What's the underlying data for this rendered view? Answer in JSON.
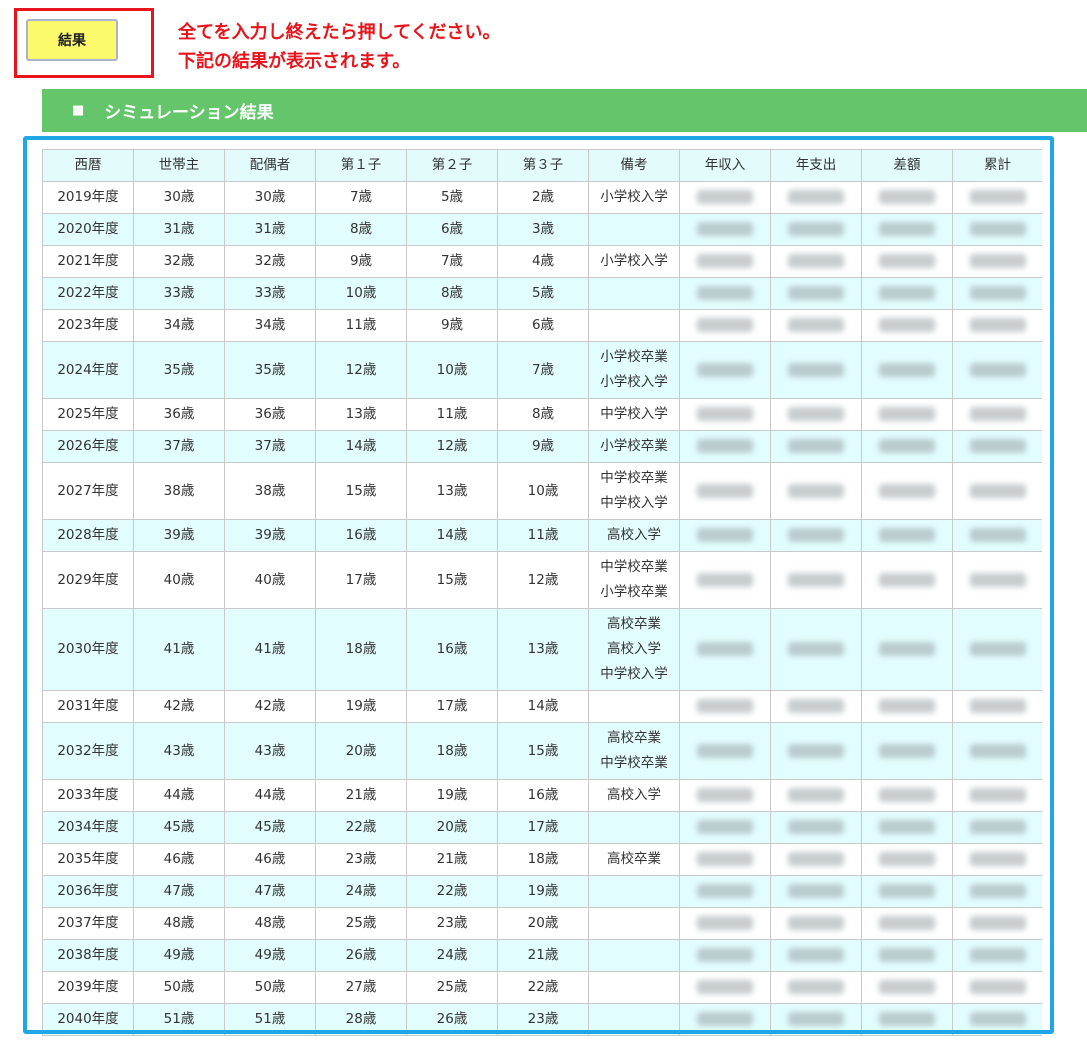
{
  "button": {
    "label": "結果"
  },
  "instruction": {
    "line1": "全てを入力し終えたら押してください。",
    "line2": "下記の結果が表示されます。"
  },
  "section": {
    "marker": "■",
    "title": "シミュレーション結果"
  },
  "table": {
    "headers": [
      "西暦",
      "世帯主",
      "配偶者",
      "第１子",
      "第２子",
      "第３子",
      "備考",
      "年収入",
      "年支出",
      "差額",
      "累計"
    ],
    "rows": [
      {
        "year": "2019年度",
        "head": "30歳",
        "spouse": "30歳",
        "c1": "7歳",
        "c2": "5歳",
        "c3": "2歳",
        "notes": [
          "小学校入学"
        ]
      },
      {
        "year": "2020年度",
        "head": "31歳",
        "spouse": "31歳",
        "c1": "8歳",
        "c2": "6歳",
        "c3": "3歳",
        "notes": []
      },
      {
        "year": "2021年度",
        "head": "32歳",
        "spouse": "32歳",
        "c1": "9歳",
        "c2": "7歳",
        "c3": "4歳",
        "notes": [
          "小学校入学"
        ]
      },
      {
        "year": "2022年度",
        "head": "33歳",
        "spouse": "33歳",
        "c1": "10歳",
        "c2": "8歳",
        "c3": "5歳",
        "notes": []
      },
      {
        "year": "2023年度",
        "head": "34歳",
        "spouse": "34歳",
        "c1": "11歳",
        "c2": "9歳",
        "c3": "6歳",
        "notes": []
      },
      {
        "year": "2024年度",
        "head": "35歳",
        "spouse": "35歳",
        "c1": "12歳",
        "c2": "10歳",
        "c3": "7歳",
        "notes": [
          "小学校卒業",
          "小学校入学"
        ]
      },
      {
        "year": "2025年度",
        "head": "36歳",
        "spouse": "36歳",
        "c1": "13歳",
        "c2": "11歳",
        "c3": "8歳",
        "notes": [
          "中学校入学"
        ]
      },
      {
        "year": "2026年度",
        "head": "37歳",
        "spouse": "37歳",
        "c1": "14歳",
        "c2": "12歳",
        "c3": "9歳",
        "notes": [
          "小学校卒業"
        ]
      },
      {
        "year": "2027年度",
        "head": "38歳",
        "spouse": "38歳",
        "c1": "15歳",
        "c2": "13歳",
        "c3": "10歳",
        "notes": [
          "中学校卒業",
          "中学校入学"
        ]
      },
      {
        "year": "2028年度",
        "head": "39歳",
        "spouse": "39歳",
        "c1": "16歳",
        "c2": "14歳",
        "c3": "11歳",
        "notes": [
          "高校入学"
        ]
      },
      {
        "year": "2029年度",
        "head": "40歳",
        "spouse": "40歳",
        "c1": "17歳",
        "c2": "15歳",
        "c3": "12歳",
        "notes": [
          "中学校卒業",
          "小学校卒業"
        ]
      },
      {
        "year": "2030年度",
        "head": "41歳",
        "spouse": "41歳",
        "c1": "18歳",
        "c2": "16歳",
        "c3": "13歳",
        "notes": [
          "高校卒業",
          "高校入学",
          "中学校入学"
        ]
      },
      {
        "year": "2031年度",
        "head": "42歳",
        "spouse": "42歳",
        "c1": "19歳",
        "c2": "17歳",
        "c3": "14歳",
        "notes": []
      },
      {
        "year": "2032年度",
        "head": "43歳",
        "spouse": "43歳",
        "c1": "20歳",
        "c2": "18歳",
        "c3": "15歳",
        "notes": [
          "高校卒業",
          "中学校卒業"
        ]
      },
      {
        "year": "2033年度",
        "head": "44歳",
        "spouse": "44歳",
        "c1": "21歳",
        "c2": "19歳",
        "c3": "16歳",
        "notes": [
          "高校入学"
        ]
      },
      {
        "year": "2034年度",
        "head": "45歳",
        "spouse": "45歳",
        "c1": "22歳",
        "c2": "20歳",
        "c3": "17歳",
        "notes": []
      },
      {
        "year": "2035年度",
        "head": "46歳",
        "spouse": "46歳",
        "c1": "23歳",
        "c2": "21歳",
        "c3": "18歳",
        "notes": [
          "高校卒業"
        ]
      },
      {
        "year": "2036年度",
        "head": "47歳",
        "spouse": "47歳",
        "c1": "24歳",
        "c2": "22歳",
        "c3": "19歳",
        "notes": []
      },
      {
        "year": "2037年度",
        "head": "48歳",
        "spouse": "48歳",
        "c1": "25歳",
        "c2": "23歳",
        "c3": "20歳",
        "notes": []
      },
      {
        "year": "2038年度",
        "head": "49歳",
        "spouse": "49歳",
        "c1": "26歳",
        "c2": "24歳",
        "c3": "21歳",
        "notes": []
      },
      {
        "year": "2039年度",
        "head": "50歳",
        "spouse": "50歳",
        "c1": "27歳",
        "c2": "25歳",
        "c3": "22歳",
        "notes": []
      },
      {
        "year": "2040年度",
        "head": "51歳",
        "spouse": "51歳",
        "c1": "28歳",
        "c2": "26歳",
        "c3": "23歳",
        "notes": []
      }
    ]
  },
  "colors": {
    "highlight_border": "#e8141c",
    "button_bg": "#fafa6a",
    "header_bar": "#64c56a",
    "frame_border": "#1fa6e6",
    "row_alt": "#e2fdfd"
  }
}
